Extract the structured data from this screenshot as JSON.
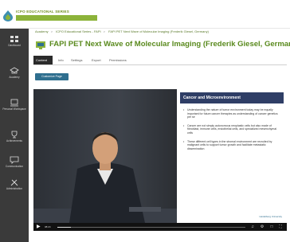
{
  "app": {
    "series_title": "ICPO EDUCATIONAL SERIES"
  },
  "sidebar": {
    "items": [
      {
        "label": "Dashboard",
        "icon": "dashboard-icon"
      },
      {
        "label": "Academy",
        "icon": "academy-icon"
      },
      {
        "label": "Personal Workspace",
        "icon": "workspace-icon"
      },
      {
        "label": "Achievements",
        "icon": "trophy-icon"
      },
      {
        "label": "Communication",
        "icon": "chat-icon"
      },
      {
        "label": "Administration",
        "icon": "tools-icon"
      }
    ]
  },
  "breadcrumb": {
    "items": [
      "Academy",
      "ICPO Educational Series - FAPI",
      "FAPI PET Next Wave of Molecular Imaging (Frederik Giesel, Germany)"
    ]
  },
  "page": {
    "title": "FAPI PET Next Wave of Molecular Imaging (Frederik Giesel, Germany)"
  },
  "tabs": [
    {
      "label": "Content",
      "active": true
    },
    {
      "label": "Info",
      "active": false
    },
    {
      "label": "Settings",
      "active": false
    },
    {
      "label": "Export",
      "active": false
    },
    {
      "label": "Permissions",
      "active": false
    }
  ],
  "buttons": {
    "customize": "Customize Page"
  },
  "slide": {
    "title": "Cancer and Microenvironment",
    "bullets": [
      "Understanding the nature of tumor environment today may be equally important for future cancer therapies as understanding of cancer genetics per se",
      "Cancer are not simply autonomous neoplastic cells but also made of fibroblast, immune cells, endothelial cells, and specialized mesenchymal cells",
      "These different cell types in the stromal environment are recruited by malignant cells to support tumor growth and facilitate metastatic dissemination"
    ],
    "footer": "Heidelberg University"
  },
  "player": {
    "current_time": "08:24",
    "progress_fraction": 0.07
  }
}
